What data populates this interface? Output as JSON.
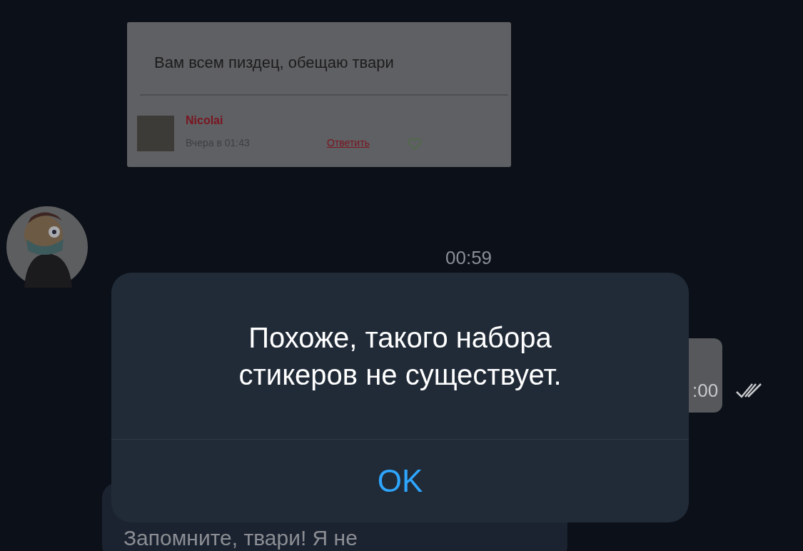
{
  "chat": {
    "comment_image": {
      "text": "Вам всем пиздец, обещаю твари",
      "author": "Nicolai",
      "time": "Вчера в 01:43",
      "reply_link": "Ответить"
    },
    "sticker_time": "00:59",
    "partial_message": {
      "time": ":00"
    },
    "bottom_message": {
      "text": "Запомните, твари! Я не"
    }
  },
  "dialog": {
    "message": "Похоже, такого набора стикеров не существует.",
    "buttons": [
      "OK"
    ]
  }
}
